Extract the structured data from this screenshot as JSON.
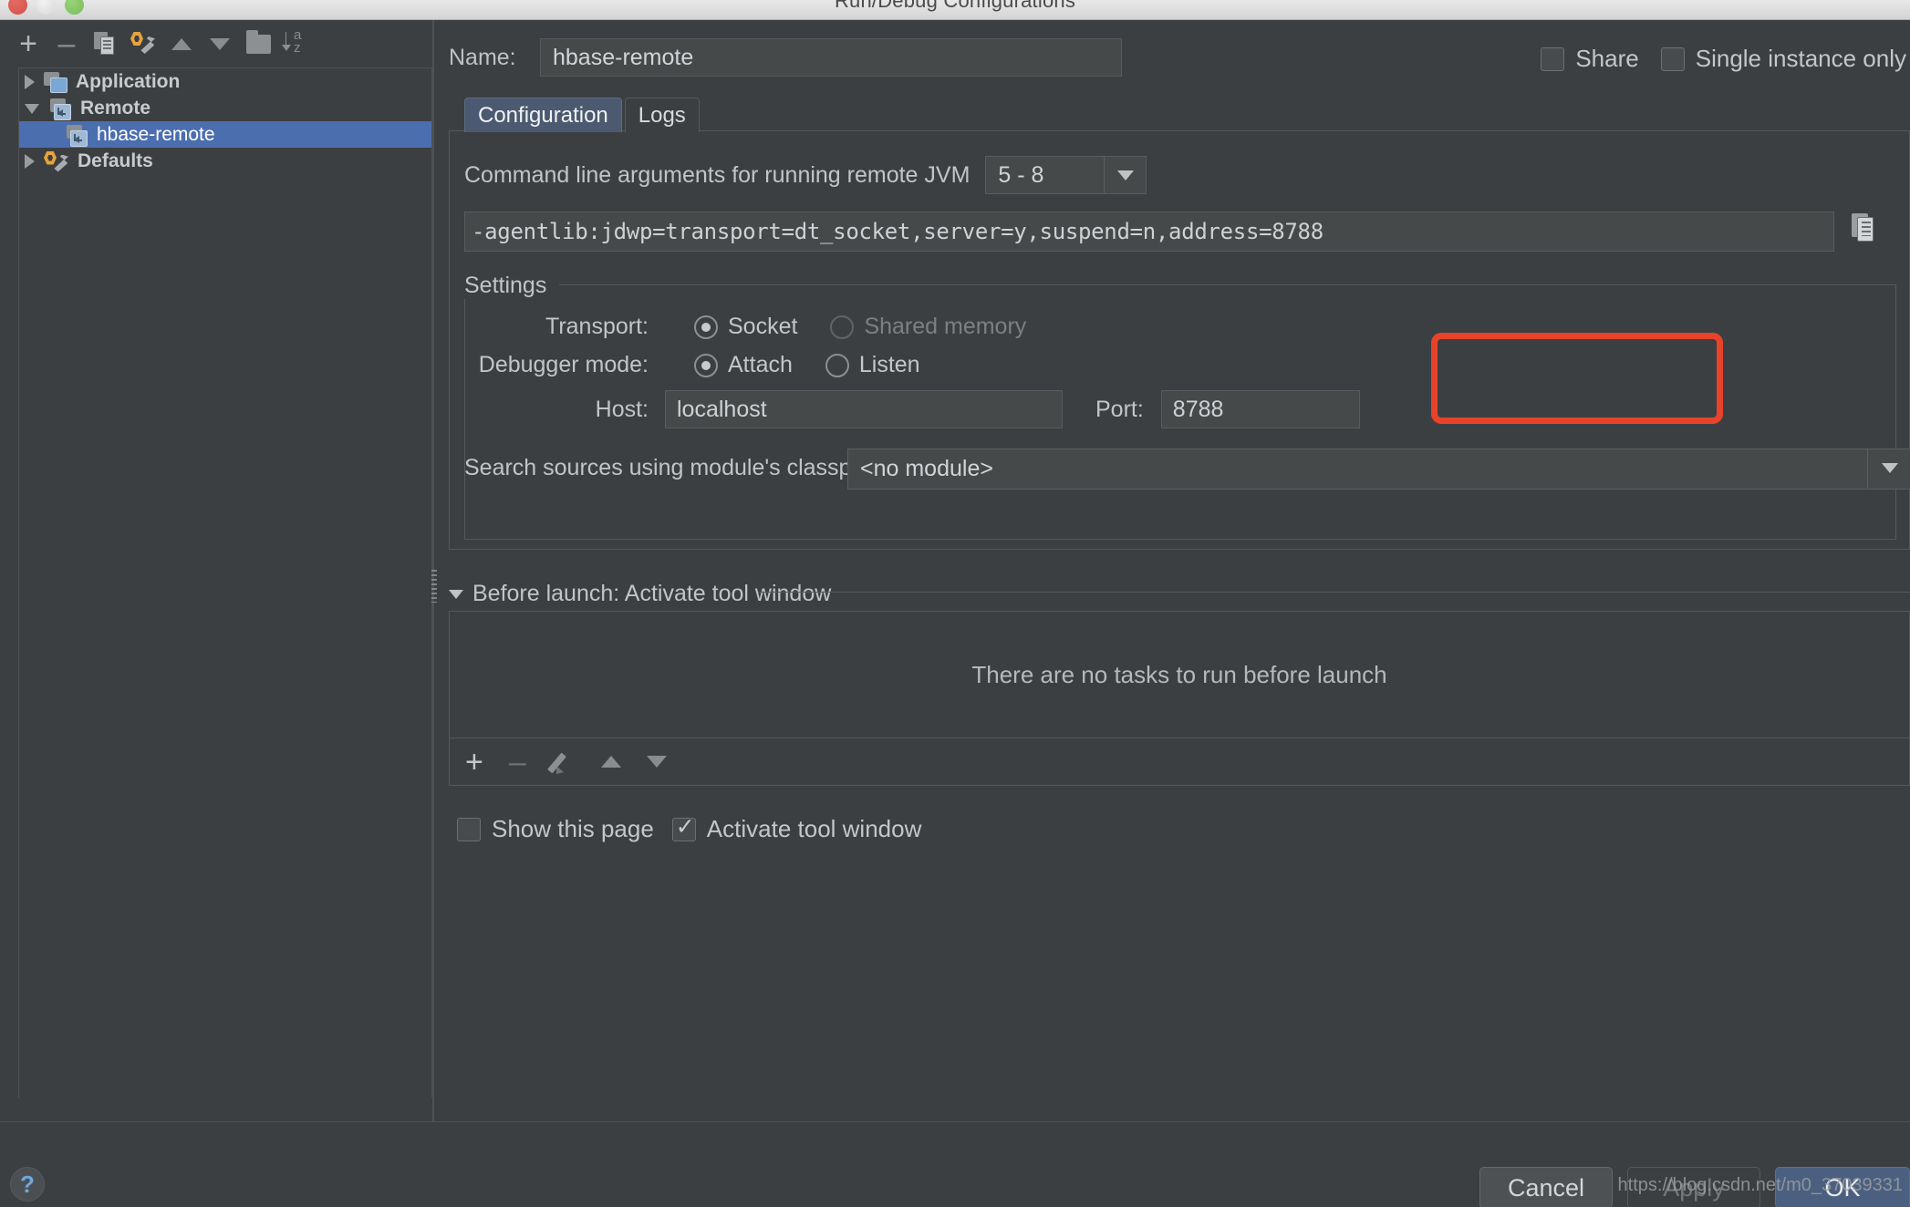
{
  "window": {
    "title": "Run/Debug Configurations",
    "traffic_lights": [
      "close",
      "minimize",
      "zoom"
    ]
  },
  "tree_toolbar": {
    "buttons": [
      {
        "name": "add",
        "icon": "plus-icon"
      },
      {
        "name": "remove",
        "icon": "minus-icon"
      },
      {
        "name": "copy",
        "icon": "copy-icon"
      },
      {
        "name": "edit-defaults",
        "icon": "wrench-icon"
      },
      {
        "name": "move-up",
        "icon": "triangle-up-icon"
      },
      {
        "name": "move-down",
        "icon": "triangle-down-icon"
      },
      {
        "name": "new-folder",
        "icon": "folder-icon"
      },
      {
        "name": "sort",
        "icon": "sort-az-icon"
      }
    ]
  },
  "tree": {
    "items": [
      {
        "label": "Application",
        "expanded": false,
        "selected": false,
        "icon": "application-icon",
        "level": 0
      },
      {
        "label": "Remote",
        "expanded": true,
        "selected": false,
        "icon": "remote-icon",
        "level": 0
      },
      {
        "label": "hbase-remote",
        "expanded": null,
        "selected": true,
        "icon": "remote-icon",
        "level": 1
      },
      {
        "label": "Defaults",
        "expanded": false,
        "selected": false,
        "icon": "defaults-icon",
        "level": 0
      }
    ]
  },
  "header": {
    "name_label": "Name:",
    "name_value": "hbase-remote",
    "share_label": "Share",
    "share_checked": false,
    "single_instance_label": "Single instance only",
    "single_instance_checked": false
  },
  "tabs": [
    {
      "label": "Configuration",
      "active": true
    },
    {
      "label": "Logs",
      "active": false
    }
  ],
  "configuration": {
    "cmd_label": "Command line arguments for running remote JVM",
    "jvm_version": "5 - 8",
    "cmd_value": "-agentlib:jdwp=transport=dt_socket,server=y,suspend=n,address=8788",
    "copy_icon": "copy-icon",
    "settings_group": "Settings",
    "transport_label": "Transport:",
    "transport_options": [
      {
        "label": "Socket",
        "selected": true,
        "disabled": false
      },
      {
        "label": "Shared memory",
        "selected": false,
        "disabled": true
      }
    ],
    "debugger_mode_label": "Debugger mode:",
    "debugger_mode_options": [
      {
        "label": "Attach",
        "selected": true,
        "disabled": false
      },
      {
        "label": "Listen",
        "selected": false,
        "disabled": false
      }
    ],
    "host_label": "Host:",
    "host_value": "localhost",
    "port_label": "Port:",
    "port_value": "8788",
    "module_label": "Search sources using module's classpath:",
    "module_value": "<no module>"
  },
  "annotation": {
    "color": "#e8432a",
    "target": "port-field"
  },
  "before_launch": {
    "title": "Before launch: Activate tool window",
    "empty_message": "There are no tasks to run before launch",
    "toolbar": [
      {
        "name": "add-task",
        "icon": "plus-icon",
        "disabled": false
      },
      {
        "name": "remove-task",
        "icon": "minus-icon",
        "disabled": true
      },
      {
        "name": "edit-task",
        "icon": "pencil-icon",
        "disabled": true
      },
      {
        "name": "move-task-up",
        "icon": "triangle-up-icon",
        "disabled": true
      },
      {
        "name": "move-task-down",
        "icon": "triangle-down-icon",
        "disabled": true
      }
    ],
    "show_page_label": "Show this page",
    "show_page_checked": false,
    "activate_tool_window_label": "Activate tool window",
    "activate_tool_window_checked": true
  },
  "footer": {
    "help_icon": "question-mark-icon",
    "cancel_label": "Cancel",
    "apply_label": "Apply",
    "apply_disabled": true,
    "ok_label": "OK"
  },
  "watermark": "https://blog.csdn.net/m0_37039331"
}
